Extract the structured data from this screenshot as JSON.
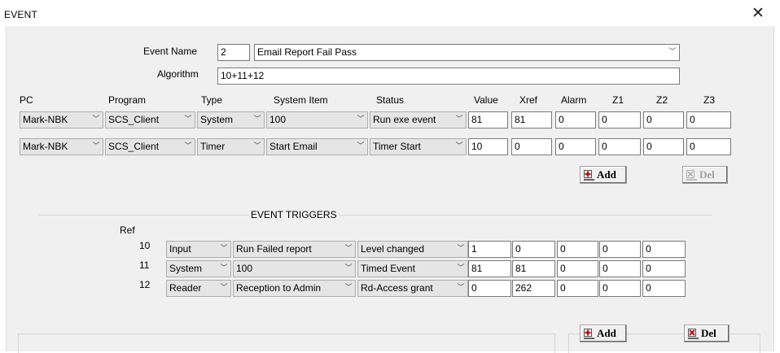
{
  "window": {
    "title": "EVENT",
    "close_symbol": "✕"
  },
  "event": {
    "name_label": "Event Name",
    "name_id": "2",
    "name_value": "Email Report Fail Pass",
    "algorithm_label": "Algorithm",
    "algorithm_value": "10+11+12"
  },
  "columns": {
    "pc": "PC",
    "program": "Program",
    "type": "Type",
    "system_item": "System Item",
    "status": "Status",
    "value": "Value",
    "xref": "Xref",
    "alarm": "Alarm",
    "z1": "Z1",
    "z2": "Z2",
    "z3": "Z3"
  },
  "actions": [
    {
      "pc": "Mark-NBK",
      "program": "SCS_Client",
      "type": "System",
      "system_item": "100",
      "status": "Run exe event",
      "value": "81",
      "xref": "81",
      "alarm": "0",
      "z1": "0",
      "z2": "0",
      "z3": "0"
    },
    {
      "pc": "Mark-NBK",
      "program": "SCS_Client",
      "type": "Timer",
      "system_item": "Start Email",
      "status": "Timer Start",
      "value": "10",
      "xref": "0",
      "alarm": "0",
      "z1": "0",
      "z2": "0",
      "z3": "0"
    }
  ],
  "buttons": {
    "add_label": "Add",
    "del_label": "Del"
  },
  "triggers": {
    "title": "EVENT TRIGGERS",
    "ref_label": "Ref",
    "rows": [
      {
        "ref": "10",
        "type": "Input",
        "item": "Run Failed report",
        "status": "Level changed",
        "value": "1",
        "xref": "0",
        "alarm": "0",
        "z1": "0",
        "z2": "0"
      },
      {
        "ref": "11",
        "type": "System",
        "item": "100",
        "status": "Timed Event",
        "value": "81",
        "xref": "81",
        "alarm": "0",
        "z1": "0",
        "z2": "0"
      },
      {
        "ref": "12",
        "type": "Reader",
        "item": "Reception to Admin",
        "status": "Rd-Access grant",
        "value": "0",
        "xref": "262",
        "alarm": "0",
        "z1": "0",
        "z2": "0"
      }
    ]
  },
  "icons": {
    "add": "add-plus-icon",
    "del": "delete-x-icon",
    "dropdown": "chevron-down-icon",
    "close": "close-icon"
  },
  "colors": {
    "add_icon": "#cc0000",
    "panel_bg": "#f0f0f0",
    "combo_bg": "#e5e5e5"
  }
}
